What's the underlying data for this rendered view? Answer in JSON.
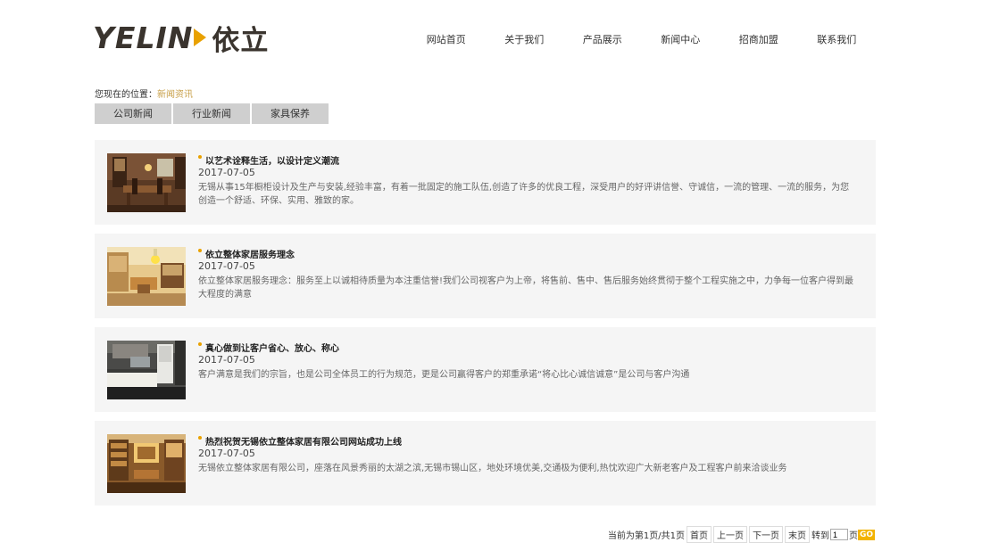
{
  "header": {
    "logo_latin_a": "YEL",
    "logo_latin_b": "IN",
    "logo_cn": "依立",
    "nav": [
      {
        "label": "网站首页"
      },
      {
        "label": "关于我们"
      },
      {
        "label": "产品展示"
      },
      {
        "label": "新闻中心"
      },
      {
        "label": "招商加盟"
      },
      {
        "label": "联系我们"
      }
    ]
  },
  "breadcrumb": {
    "prefix": "您现在的位置：",
    "current": "新闻资讯"
  },
  "tabs": [
    {
      "label": "公司新闻"
    },
    {
      "label": "行业新闻"
    },
    {
      "label": "家具保养"
    }
  ],
  "news": [
    {
      "title": "以艺术诠释生活，以设计定义潮流",
      "date": "2017-07-05",
      "summary": "无锡从事15年橱柜设计及生产与安装,经验丰富，有着一批固定的施工队伍,创造了许多的优良工程，深受用户的好评讲信誉、守诚信，一流的管理、一流的服务，为您创造一个舒适、环保、实用、雅致的家。",
      "thumb": "dining-room-image"
    },
    {
      "title": "依立整体家居服务理念",
      "date": "2017-07-05",
      "summary": "依立整体家居服务理念：服务至上以诚相待质量为本注重信誉!我们公司视客户为上帝，将售前、售中、售后服务始终贯彻于整个工程实施之中，力争每一位客户得到最大程度的满意",
      "thumb": "living-room-image"
    },
    {
      "title": "真心做到让客户省心、放心、称心",
      "date": "2017-07-05",
      "summary": "客户满意是我们的宗旨，也是公司全体员工的行为规范，更是公司赢得客户的郑重承诺“将心比心诚信诚意”是公司与客户沟通",
      "thumb": "kitchen-image"
    },
    {
      "title": "热烈祝贺无锡依立整体家居有限公司网站成功上线",
      "date": "2017-07-05",
      "summary": "无锡依立整体家居有限公司，座落在风景秀丽的太湖之滨,无锡市锡山区，地处环境优美,交通极为便利,热忱欢迎广大新老客户及工程客户前来洽谈业务",
      "thumb": "study-room-image"
    }
  ],
  "pager": {
    "info": "当前为第1页/共1页",
    "first": "首页",
    "prev": "上一页",
    "next": "下一页",
    "last": "末页",
    "goto_prefix": "转到",
    "goto_value": "1",
    "goto_suffix": "页",
    "go": "GO"
  },
  "colors": {
    "accent": "#e9a100",
    "breadcrumb_current": "#c8a04a",
    "tab_bg": "#cfcfcf",
    "card_bg": "#f5f5f5"
  }
}
